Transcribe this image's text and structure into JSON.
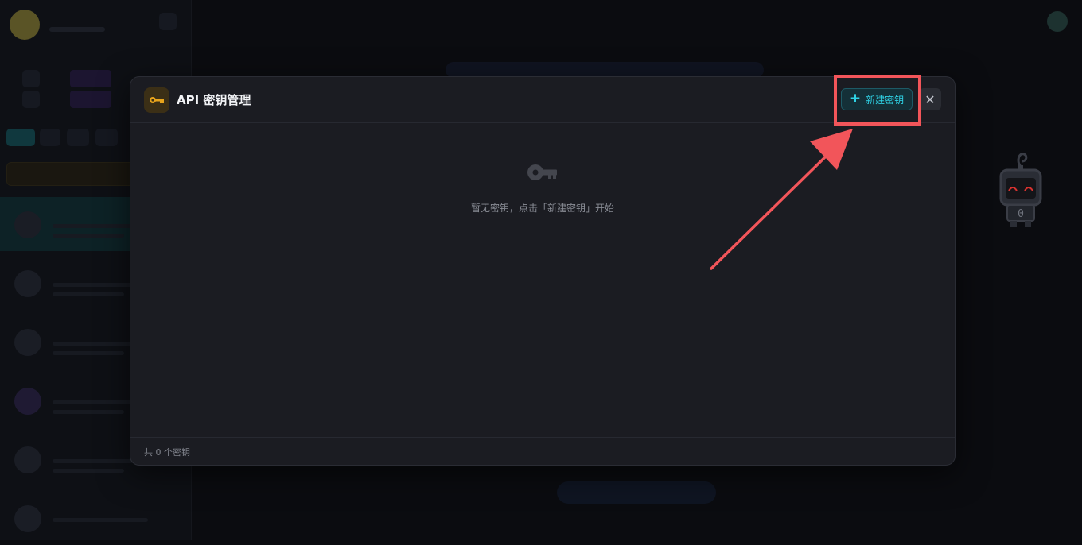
{
  "modal": {
    "title": "API 密钥管理",
    "title_icon": "key-icon",
    "new_key_button": {
      "label": "新建密钥",
      "icon": "plus-icon",
      "accent": "#2fd3e6"
    },
    "close_button": {
      "icon": "close-icon",
      "glyph": "✕"
    },
    "empty_state": {
      "icon": "key-icon",
      "text": "暂无密钥，点击「新建密钥」开始"
    },
    "footer": {
      "count_text": "共 0 个密钥"
    }
  },
  "annotation": {
    "highlight_color": "#f2555a",
    "target": "new-key-button"
  },
  "colors": {
    "modal_bg": "#1b1c22",
    "key_icon_gold": "#e8a41c",
    "backdrop": "#0b0c10"
  }
}
